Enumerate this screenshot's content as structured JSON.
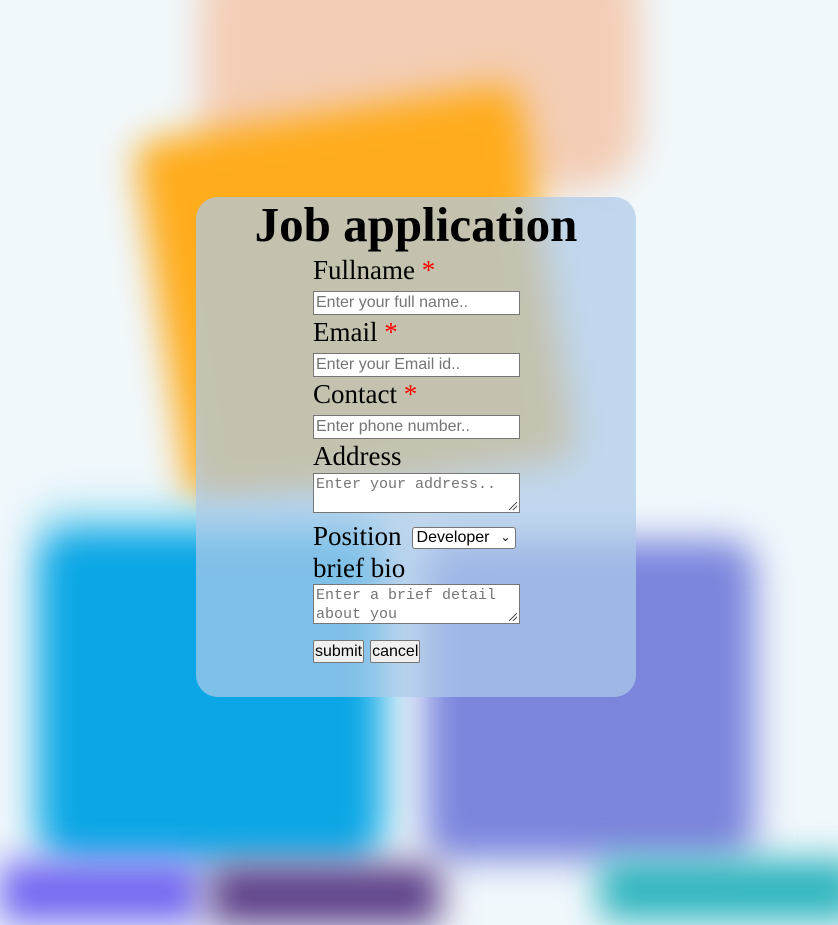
{
  "form": {
    "title": "Job application",
    "required_marker": "*",
    "fullname": {
      "label": "Fullname",
      "placeholder": "Enter your full name.."
    },
    "email": {
      "label": "Email",
      "placeholder": "Enter your Email id.."
    },
    "contact": {
      "label": "Contact",
      "placeholder": "Enter phone number.."
    },
    "address": {
      "label": "Address",
      "placeholder": "Enter your address.."
    },
    "position": {
      "label": "Position",
      "selected": "Developer"
    },
    "bio": {
      "label": "brief bio",
      "placeholder": "Enter a brief detail about you"
    },
    "buttons": {
      "submit": "submit",
      "cancel": "cancel"
    }
  },
  "colors": {
    "required": "#ff0000",
    "card": "#adcbe9"
  },
  "icons": {
    "select_arrow": "chevron-down-icon",
    "textarea_resize": "resize-handle-icon"
  }
}
